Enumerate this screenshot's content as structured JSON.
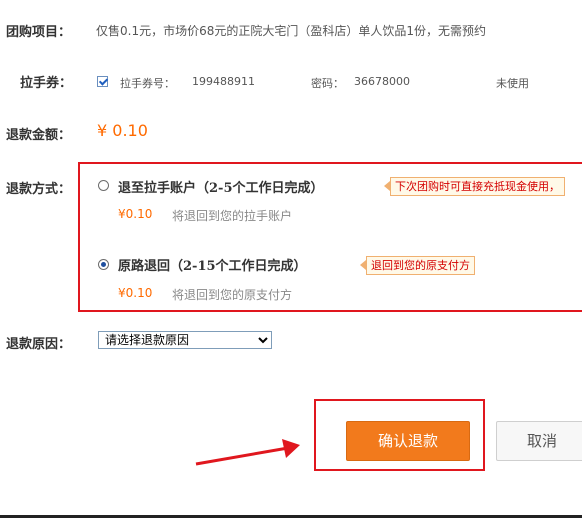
{
  "labels": {
    "deal_item": "团购项目：",
    "voucher": "拉手券：",
    "refund_amount": "退款金额：",
    "refund_method": "退款方式：",
    "refund_reason": "退款原因："
  },
  "deal_item_text": "仅售0.1元，市场价68元的正院大宅门（盈科店）单人饮品1份，无需预约",
  "voucher": {
    "number_label": "拉手券号：",
    "number": "199488911",
    "password_label": "密码：",
    "password": "36678000",
    "status": "未使用"
  },
  "refund_amount": "¥ 0.10",
  "refund_options": [
    {
      "title": "退至拉手账户（2-5个工作日完成）",
      "tag": "下次团购时可直接充抵现金使用，",
      "amount": "¥0.10",
      "desc": "将退回到您的拉手账户",
      "selected": false
    },
    {
      "title": "原路退回（2-15个工作日完成）",
      "tag": "退回到您的原支付方",
      "amount": "¥0.10",
      "desc": "将退回到您的原支付方",
      "selected": true
    }
  ],
  "refund_reason_select": "请选择退款原因",
  "buttons": {
    "confirm": "确认退款",
    "cancel": "取消"
  },
  "colors": {
    "accent_orange": "#ff6a00",
    "highlight_red": "#e0171e",
    "button_orange": "#f27a1c"
  }
}
